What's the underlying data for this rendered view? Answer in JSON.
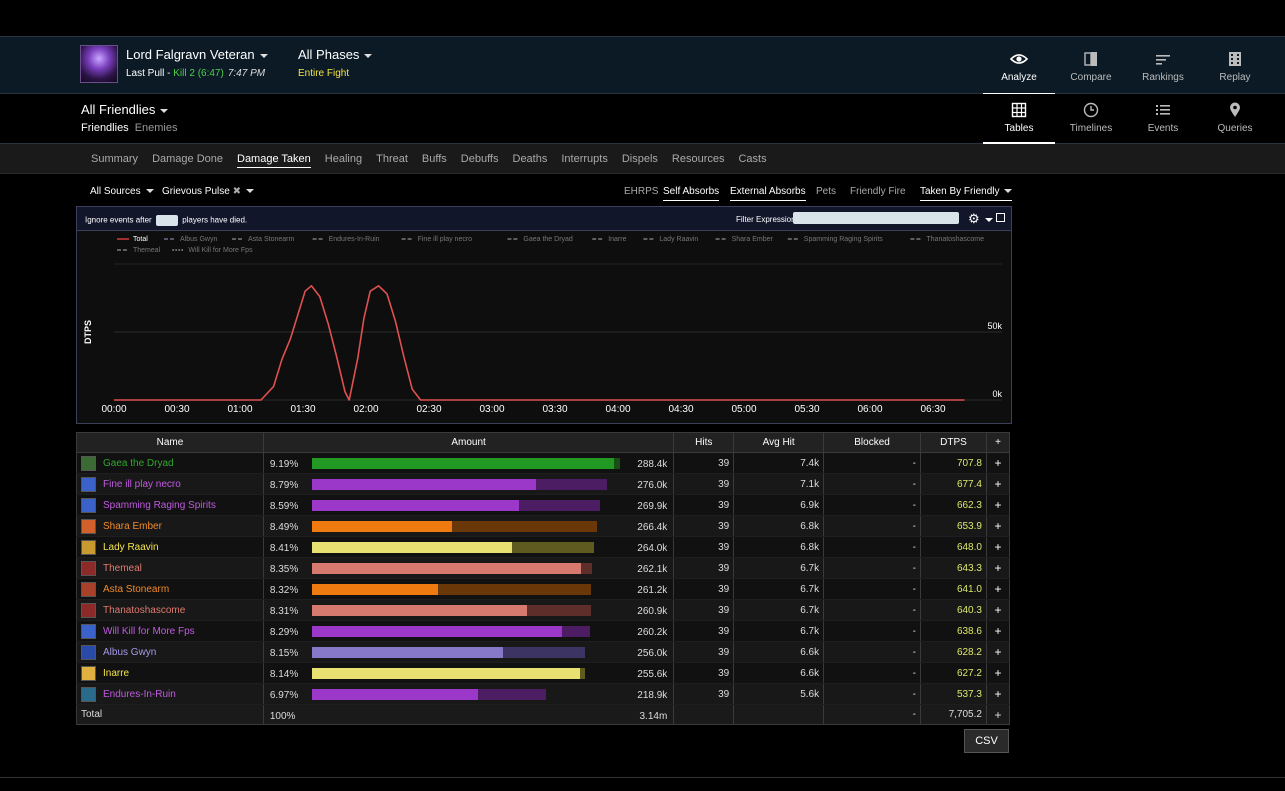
{
  "header": {
    "boss_name": "Lord Falgravn Veteran",
    "pull_label": "Last Pull - ",
    "kill_label": "Kill 2 (6:47)",
    "pull_time": "7:47 PM",
    "phase_title": "All Phases",
    "phase_sub": "Entire Fight",
    "nav": [
      {
        "label": "Analyze",
        "icon": "eye-icon",
        "active": true
      },
      {
        "label": "Compare",
        "icon": "compare-icon"
      },
      {
        "label": "Rankings",
        "icon": "rankings-icon"
      },
      {
        "label": "Replay",
        "icon": "replay-icon"
      }
    ]
  },
  "subheader": {
    "title": "All Friendlies",
    "friendlies": "Friendlies",
    "enemies": "Enemies",
    "views": [
      {
        "label": "Tables",
        "icon": "grid-icon",
        "active": true
      },
      {
        "label": "Timelines",
        "icon": "clock-icon"
      },
      {
        "label": "Events",
        "icon": "list-icon"
      },
      {
        "label": "Queries",
        "icon": "pin-icon"
      }
    ]
  },
  "tabs": [
    "Summary",
    "Damage Done",
    "Damage Taken",
    "Healing",
    "Threat",
    "Buffs",
    "Debuffs",
    "Deaths",
    "Interrupts",
    "Dispels",
    "Resources",
    "Casts"
  ],
  "active_tab": "Damage Taken",
  "filters": {
    "sources": "All Sources",
    "ability": "Grievous Pulse",
    "options": [
      "EHRPS",
      "Self Absorbs",
      "External Absorbs",
      "Pets",
      "Friendly Fire"
    ],
    "options_on": [
      "Self Absorbs",
      "External Absorbs"
    ],
    "taken_by": "Taken By Friendly"
  },
  "panel": {
    "ignore_prefix": "Ignore events after",
    "ignore_suffix": "players have died.",
    "filter_label": "Filter Expression:"
  },
  "chart_data": {
    "type": "line",
    "ylabel": "DTPS",
    "y_ticks": [
      "0k",
      "50k"
    ],
    "x_ticks": [
      "00:00",
      "00:30",
      "01:00",
      "01:30",
      "02:00",
      "02:30",
      "03:00",
      "03:30",
      "04:00",
      "04:30",
      "05:00",
      "05:30",
      "06:00",
      "06:30"
    ],
    "legend": [
      "Total",
      "Albus Gwyn",
      "Asta Stonearm",
      "Endures-In-Ruin",
      "Fine ill play necro",
      "Gaea the Dryad",
      "Inarre",
      "Lady Raavin",
      "Shara Ember",
      "Spamming Raging Spirits",
      "Thanatoshascome",
      "Themeal",
      "Will Kill for More Fps"
    ],
    "legend_colors": [
      "#e04040",
      "#6f6f8a",
      "#7a7a7a",
      "#7a7a7a",
      "#7a7a7a",
      "#7a7a7a",
      "#7a7a7a",
      "#7a7a7a",
      "#7a7a7a",
      "#7a7a7a",
      "#7a7a7a",
      "#7a7a7a",
      "#9a9a9a"
    ],
    "series": [
      {
        "name": "Total",
        "color": "#e05050",
        "x": [
          0,
          70,
          76,
          80,
          84,
          88,
          91,
          94,
          98,
          102,
          106,
          110,
          112,
          116,
          119,
          122,
          126,
          130,
          134,
          138,
          142,
          146,
          150,
          405
        ],
        "y": [
          0,
          0,
          10,
          30,
          45,
          65,
          80,
          84,
          76,
          56,
          32,
          6,
          0,
          30,
          60,
          80,
          84,
          78,
          58,
          32,
          8,
          0,
          0,
          0
        ]
      }
    ],
    "x_range": [
      0,
      410
    ],
    "y_range": [
      0,
      100
    ]
  },
  "table": {
    "columns": [
      "Name",
      "Amount",
      "Hits",
      "Avg Hit",
      "Blocked",
      "DTPS",
      "+"
    ],
    "rows": [
      {
        "name": "Gaea the Dryad",
        "color": "#2fa82f",
        "fill": "#229922",
        "track": "#174f17",
        "icon": "#3c6a34",
        "pct": "9.19%",
        "pct_val": 9.19,
        "fill_frac": 0.98,
        "amount": "288.4k",
        "hits": "39",
        "avg": "7.4k",
        "blocked": "-",
        "dtps": "707.8"
      },
      {
        "name": "Fine ill play necro",
        "color": "#c05ae0",
        "fill": "#9b38c9",
        "track": "#4c1d63",
        "icon": "#3a62c8",
        "pct": "8.79%",
        "pct_val": 8.79,
        "fill_frac": 0.76,
        "amount": "276.0k",
        "hits": "39",
        "avg": "7.1k",
        "blocked": "-",
        "dtps": "677.4"
      },
      {
        "name": "Spamming Raging Spirits",
        "color": "#c05ae0",
        "fill": "#9b38c9",
        "track": "#4c1d63",
        "icon": "#3a62c8",
        "pct": "8.59%",
        "pct_val": 8.59,
        "fill_frac": 0.72,
        "amount": "269.9k",
        "hits": "39",
        "avg": "6.9k",
        "blocked": "-",
        "dtps": "662.3"
      },
      {
        "name": "Shara Ember",
        "color": "#f08a2a",
        "fill": "#ee7a10",
        "track": "#6a3808",
        "icon": "#d2602a",
        "pct": "8.49%",
        "pct_val": 8.49,
        "fill_frac": 0.49,
        "amount": "266.4k",
        "hits": "39",
        "avg": "6.8k",
        "blocked": "-",
        "dtps": "653.9"
      },
      {
        "name": "Lady Raavin",
        "color": "#f4e34a",
        "fill": "#e8e070",
        "track": "#5e5a20",
        "icon": "#c89a30",
        "pct": "8.41%",
        "pct_val": 8.41,
        "fill_frac": 0.71,
        "amount": "264.0k",
        "hits": "39",
        "avg": "6.8k",
        "blocked": "-",
        "dtps": "648.0"
      },
      {
        "name": "Themeal",
        "color": "#e07a70",
        "fill": "#d67a70",
        "track": "#5e2e2a",
        "icon": "#8c2a2a",
        "pct": "8.35%",
        "pct_val": 8.35,
        "fill_frac": 0.96,
        "amount": "262.1k",
        "hits": "39",
        "avg": "6.7k",
        "blocked": "-",
        "dtps": "643.3"
      },
      {
        "name": "Asta Stonearm",
        "color": "#f08a2a",
        "fill": "#ee7a10",
        "track": "#6a3808",
        "icon": "#a8402a",
        "pct": "8.32%",
        "pct_val": 8.32,
        "fill_frac": 0.45,
        "amount": "261.2k",
        "hits": "39",
        "avg": "6.7k",
        "blocked": "-",
        "dtps": "641.0"
      },
      {
        "name": "Thanatoshascome",
        "color": "#e07a70",
        "fill": "#d67a70",
        "track": "#5e2e2a",
        "icon": "#8c2a2a",
        "pct": "8.31%",
        "pct_val": 8.31,
        "fill_frac": 0.77,
        "amount": "260.9k",
        "hits": "39",
        "avg": "6.7k",
        "blocked": "-",
        "dtps": "640.3"
      },
      {
        "name": "Will Kill for More Fps",
        "color": "#c05ae0",
        "fill": "#9b38c9",
        "track": "#4c1d63",
        "icon": "#3a62c8",
        "pct": "8.29%",
        "pct_val": 8.29,
        "fill_frac": 0.9,
        "amount": "260.2k",
        "hits": "39",
        "avg": "6.7k",
        "blocked": "-",
        "dtps": "638.6"
      },
      {
        "name": "Albus Gwyn",
        "color": "#a598e8",
        "fill": "#8878c8",
        "track": "#3c3564",
        "icon": "#2a4aa8",
        "pct": "8.15%",
        "pct_val": 8.15,
        "fill_frac": 0.7,
        "amount": "256.0k",
        "hits": "39",
        "avg": "6.6k",
        "blocked": "-",
        "dtps": "628.2"
      },
      {
        "name": "Inarre",
        "color": "#f4e34a",
        "fill": "#e8e070",
        "track": "#5e5a20",
        "icon": "#e0b040",
        "pct": "8.14%",
        "pct_val": 8.14,
        "fill_frac": 0.98,
        "amount": "255.6k",
        "hits": "39",
        "avg": "6.6k",
        "blocked": "-",
        "dtps": "627.2"
      },
      {
        "name": "Endures-In-Ruin",
        "color": "#c05ae0",
        "fill": "#9b38c9",
        "track": "#4c1d63",
        "icon": "#2a6a8a",
        "pct": "6.97%",
        "pct_val": 6.97,
        "fill_frac": 0.71,
        "amount": "218.9k",
        "hits": "39",
        "avg": "5.6k",
        "blocked": "-",
        "dtps": "537.3"
      }
    ],
    "total": {
      "label": "Total",
      "pct": "100%",
      "amount": "3.14m",
      "blocked": "-",
      "dtps": "7,705.2"
    }
  },
  "csv_label": "CSV"
}
